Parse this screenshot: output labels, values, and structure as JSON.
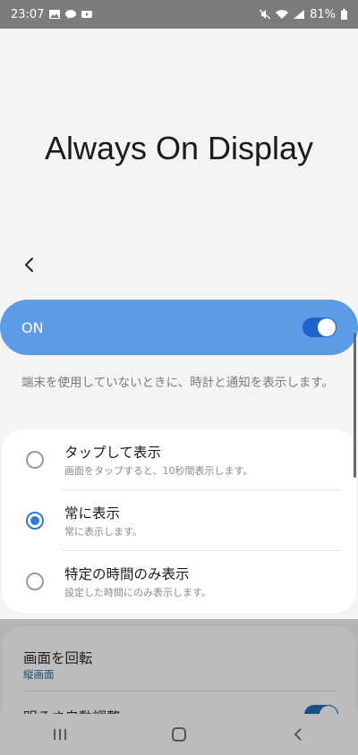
{
  "status_bar": {
    "time": "23:07",
    "battery": "81%",
    "left_icons": [
      "image-icon",
      "chat-icon",
      "youtube-icon"
    ],
    "right_icons": [
      "mute-icon",
      "wifi-icon",
      "signal-icon",
      "battery-icon"
    ]
  },
  "page": {
    "title": "Always On Display"
  },
  "master_toggle": {
    "label": "ON",
    "state": true
  },
  "description": "端末を使用していないときに、時計と通知を表示します。",
  "options": [
    {
      "label": "タップして表示",
      "sub": "画面をタップすると、10秒間表示します。",
      "selected": false
    },
    {
      "label": "常に表示",
      "sub": "常に表示します。",
      "selected": true
    },
    {
      "label": "特定の時間のみ表示",
      "sub": "設定した時間にのみ表示します。",
      "selected": false
    }
  ],
  "settings": {
    "rotate_title": "画面を回転",
    "rotate_value": "縦画面",
    "brightness_title": "明るさ自動調整",
    "brightness_state": true
  },
  "colors": {
    "accent": "#5c9be6",
    "radio_selected": "#2f79d8"
  },
  "nav": [
    "recents-icon",
    "home-icon",
    "back-icon"
  ]
}
